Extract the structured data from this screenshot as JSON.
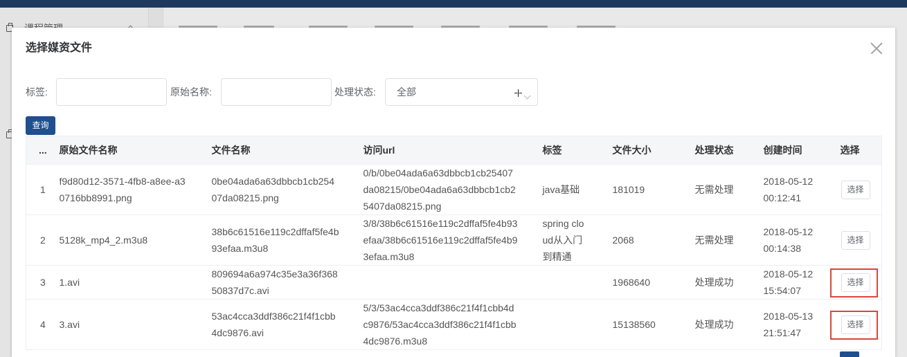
{
  "sidebar": {
    "section_label": "课程管理",
    "section_icon": "menu-section-icon"
  },
  "dialog": {
    "title": "选择媒资文件",
    "close_icon": "close-icon",
    "filters": {
      "tag_label": "标签:",
      "tag_value": "",
      "original_name_label": "原始名称:",
      "original_name_value": "",
      "status_label": "处理状态:",
      "status_selected": "全部"
    },
    "query_button": "查询",
    "table": {
      "columns": [
        "...",
        "原始文件名称",
        "文件名称",
        "访问url",
        "标签",
        "文件大小",
        "处理状态",
        "创建时间",
        "选择"
      ],
      "rows": [
        {
          "index": "1",
          "original_name": "f9d80d12-3571-4fb8-a8ee-a3\n0716bb8991.png",
          "file_name": "0be04ada6a63dbbcb1cb254\n07da08215.png",
          "url": "0/b/0be04ada6a63dbbcb1cb25407\nda08215/0be04ada6a63dbbcb1cb2\n5407da08215.png",
          "tag": "java基础",
          "file_size": "181019",
          "status": "无需处理",
          "created_at": "2018-05-12\n00:12:41",
          "action": "选择",
          "highlighted": false
        },
        {
          "index": "2",
          "original_name": "5128k_mp4_2.m3u8",
          "file_name": "38b6c61516e119c2dffaf5fe4b\n93efaa.m3u8",
          "url": "3/8/38b6c61516e119c2dffaf5fe4b93\nefaa/38b6c61516e119c2dffaf5fe4b9\n3efaa.m3u8",
          "tag": "spring clo\nud从入门\n到精通",
          "file_size": "2068",
          "status": "无需处理",
          "created_at": "2018-05-12\n00:14:38",
          "action": "选择",
          "highlighted": false
        },
        {
          "index": "3",
          "original_name": "1.avi",
          "file_name": "809694a6a974c35e3a36f368\n50837d7c.avi",
          "url": "",
          "tag": "",
          "file_size": "1968640",
          "status": "处理成功",
          "created_at": "2018-05-12\n15:54:07",
          "action": "选择",
          "highlighted": true
        },
        {
          "index": "4",
          "original_name": "3.avi",
          "file_name": "53ac4cca3ddf386c21f4f1cbb\n4dc9876.avi",
          "url": "5/3/53ac4cca3ddf386c21f4f1cbb4d\nc9876/53ac4cca3ddf386c21f4f1cbb\n4dc9876.m3u8",
          "tag": "",
          "file_size": "15138560",
          "status": "处理成功",
          "created_at": "2018-05-13\n21:51:47",
          "action": "选择",
          "highlighted": true
        }
      ]
    }
  },
  "colors": {
    "top_bar": "#1d3a5e",
    "primary_button": "#1f4f8f",
    "highlight_box": "#d9453c",
    "table_header_bg": "#f5f6f8"
  }
}
